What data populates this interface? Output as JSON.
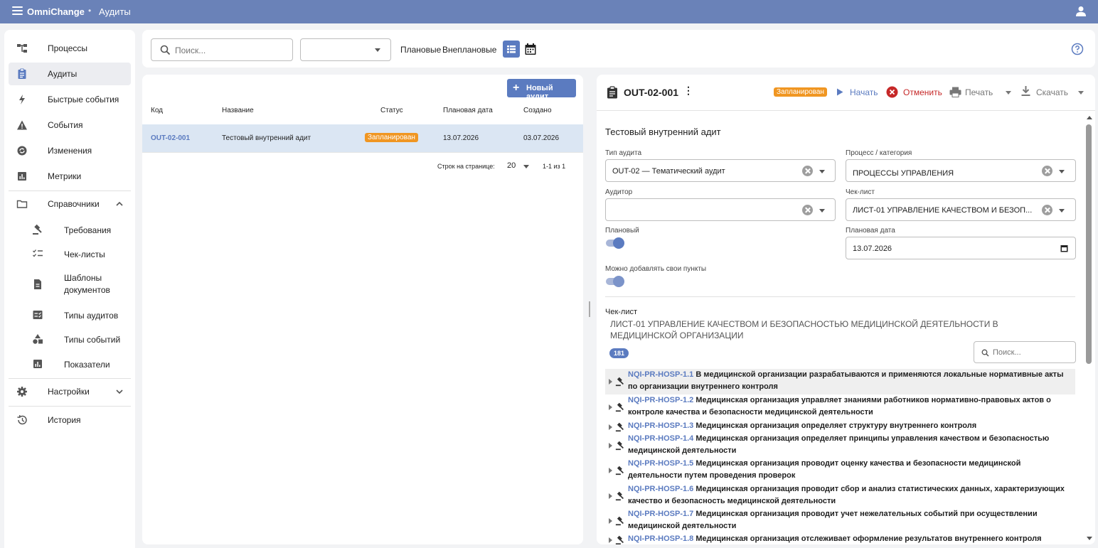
{
  "app": {
    "title": "OmniChange",
    "breadcrumb": "Аудиты"
  },
  "colors": {
    "topbar": "#6a82b8",
    "accent": "#5b7bc0",
    "status_planned": "#f09622",
    "cancel": "#c62828"
  },
  "sidebar": {
    "items": [
      {
        "label": "Процессы",
        "icon": "process-icon"
      },
      {
        "label": "Аудиты",
        "icon": "clipboard-icon",
        "active": true
      },
      {
        "label": "Быстрые события",
        "icon": "bolt-icon"
      },
      {
        "label": "События",
        "icon": "warning-icon"
      },
      {
        "label": "Изменения",
        "icon": "changes-icon"
      },
      {
        "label": "Метрики",
        "icon": "chart-icon"
      }
    ],
    "references": {
      "label": "Справочники",
      "items": [
        {
          "label": "Требования",
          "icon": "gavel-icon"
        },
        {
          "label": "Чек-листы",
          "icon": "checklist-icon"
        },
        {
          "label": "Шаблоны документов",
          "icon": "document-icon"
        },
        {
          "label": "Типы аудитов",
          "icon": "audit-types-icon"
        },
        {
          "label": "Типы событий",
          "icon": "shapes-icon"
        },
        {
          "label": "Показатели",
          "icon": "indicators-icon"
        }
      ]
    },
    "settings": "Настройки",
    "history": "История"
  },
  "toolbar": {
    "search_placeholder": "Поиск...",
    "filter_planned": "Плановые",
    "filter_unplanned": "Внеплановые"
  },
  "list": {
    "new_button": "Новый аудит",
    "columns": [
      "Код",
      "Название",
      "Статус",
      "Плановая дата",
      "Создано"
    ],
    "rows": [
      {
        "code": "OUT-02-001",
        "name": "Тестовый внутренний адит",
        "status": "Запланирован",
        "planned_date": "13.07.2026",
        "created": "03.07.2026"
      }
    ],
    "pager": {
      "rows_label": "Строк на странице:",
      "rows_value": "20",
      "range": "1-1 из 1"
    }
  },
  "detail": {
    "code": "OUT-02-001",
    "status": "Запланирован",
    "actions": {
      "start": "Начать",
      "cancel": "Отменить",
      "print": "Печать",
      "download": "Скачать"
    },
    "title": "Тестовый внутренний адит",
    "fields": {
      "audit_type_label": "Тип аудита",
      "audit_type_value": "OUT-02 — Тематический аудит",
      "process_label": "Процесс / категория",
      "process_value": "ПРОЦЕССЫ УПРАВЛЕНИЯ",
      "auditor_label": "Аудитор",
      "auditor_value": "",
      "checklist_label": "Чек-лист",
      "checklist_value": "ЛИСТ-01 УПРАВЛЕНИЕ КАЧЕСТВОМ И БЕЗОП...",
      "planned_label": "Плановый",
      "planned_on": true,
      "planned_date_label": "Плановая дата",
      "planned_date_value": "13.07.2026",
      "custom_items_label": "Можно добавлять свои пункты",
      "custom_items_on": true
    },
    "checklist": {
      "label": "Чек-лист",
      "name": "ЛИСТ-01 УПРАВЛЕНИЕ КАЧЕСТВОМ И БЕЗОПАСНОСТЬЮ МЕДИЦИНСКОЙ ДЕЯТЕЛЬНОСТИ В МЕДИЦИНСКОЙ ОРГАНИЗАЦИИ",
      "count": "181",
      "search_placeholder": "Поиск...",
      "items": [
        {
          "code": "NQI-PR-HOSP-1.1",
          "text": "В медицинской организации разрабатываются и применяются локальные нормативные акты по организации внутреннего контроля"
        },
        {
          "code": "NQI-PR-HOSP-1.2",
          "text": "Медицинская организация управляет знаниями работников нормативно-правовых актов о контроле качества и безопасности медицинской деятельности"
        },
        {
          "code": "NQI-PR-HOSP-1.3",
          "text": "Медицинская организация определяет структуру внутреннего контроля"
        },
        {
          "code": "NQI-PR-HOSP-1.4",
          "text": "Медицинская организация определяет принципы управления качеством и безопасностью медицинской деятельности"
        },
        {
          "code": "NQI-PR-HOSP-1.5",
          "text": "Медицинская организация проводит оценку качества и безопасности медицинской деятельности путем проведения проверок"
        },
        {
          "code": "NQI-PR-HOSP-1.6",
          "text": "Медицинская организация проводит сбор и анализ статистических данных, характеризующих качество и безопасность медицинской деятельности"
        },
        {
          "code": "NQI-PR-HOSP-1.7",
          "text": "Медицинская организация проводит учет нежелательных событий при осуществлении медицинской деятельности"
        },
        {
          "code": "NQI-PR-HOSP-1.8",
          "text": "Медицинская организация отслеживает оформление результатов внутреннего контроля"
        }
      ]
    }
  }
}
